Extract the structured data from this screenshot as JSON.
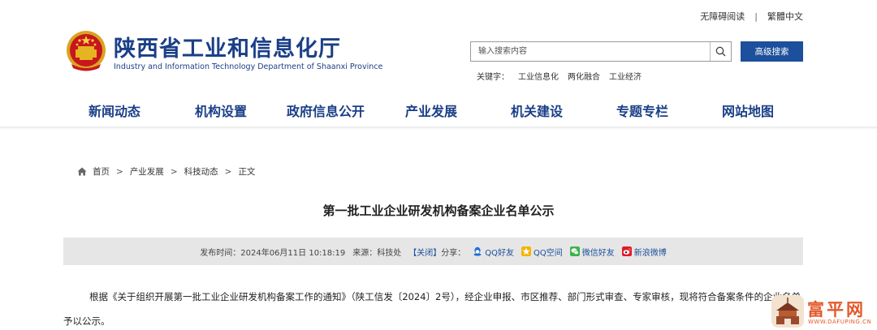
{
  "top_links": {
    "accessible": "无障碍阅读",
    "separator": "|",
    "traditional": "繁體中文"
  },
  "site": {
    "title": "陕西省工业和信息化厅",
    "subtitle": "Industry and Information Technology Department of Shaanxi Province"
  },
  "search": {
    "placeholder": "输入搜索内容",
    "advanced_label": "高级搜索"
  },
  "keywords": {
    "label": "关键字：",
    "items": [
      "工业信息化",
      "两化融合",
      "工业经济"
    ]
  },
  "nav": {
    "items": [
      "新闻动态",
      "机构设置",
      "政府信息公开",
      "产业发展",
      "机关建设",
      "专题专栏",
      "网站地图"
    ]
  },
  "breadcrumb": {
    "items": [
      "首页",
      "产业发展",
      "科技动态",
      "正文"
    ],
    "separator": ">"
  },
  "article": {
    "title": "第一批工业企业研发机构备案企业名单公示",
    "meta": {
      "publish_label": "发布时间：",
      "publish_time": "2024年06月11日 10:18:19",
      "source_label": "来源：",
      "source": "科技处",
      "close": "【关闭】",
      "share_label": "分享："
    },
    "share_targets": [
      {
        "name": "QQ好友",
        "icon": "qq-icon",
        "color": "#1e6fd9"
      },
      {
        "name": "QQ空间",
        "icon": "qzone-icon",
        "color": "#f4b400"
      },
      {
        "name": "微信好友",
        "icon": "wechat-icon",
        "color": "#3bb44a"
      },
      {
        "name": "新浪微博",
        "icon": "weibo-icon",
        "color": "#e6162d"
      }
    ],
    "body": "根据《关于组织开展第一批工业企业研发机构备案工作的通知》（陕工信发〔2024〕2号），经企业申报、市区推荐、部门形式审查、专家审核，现将符合备案条件的企业名单予以公示。"
  },
  "watermark": {
    "text": "富平网",
    "sub": "WWW.DAFUPING.CN"
  },
  "colors": {
    "brand_blue": "#1a3f87",
    "button_blue": "#1c4f9c",
    "meta_bg": "#e6e6e6"
  }
}
